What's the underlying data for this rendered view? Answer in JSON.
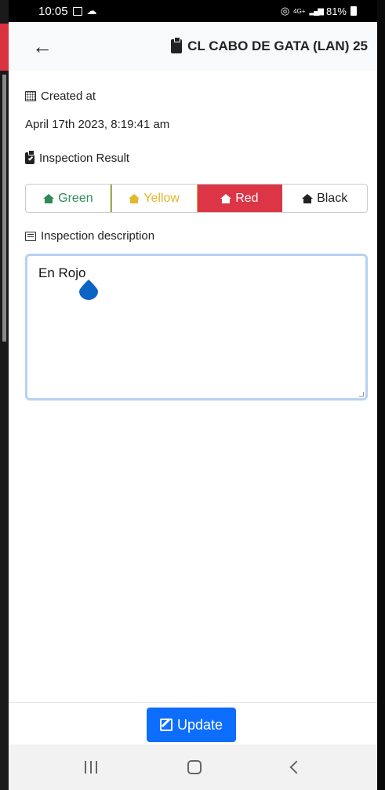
{
  "status": {
    "time": "10:05",
    "network": "4G+",
    "battery": "81%"
  },
  "header": {
    "back_icon": "arrow-left-icon",
    "title": "CL CABO DE GATA (LAN) 25"
  },
  "created": {
    "label": "Created at",
    "value": "April 17th 2023, 8:19:41 am"
  },
  "inspection_result": {
    "label": "Inspection Result",
    "options": [
      {
        "label": "Green",
        "color": "#2e8b57"
      },
      {
        "label": "Yellow",
        "color": "#e0b82a"
      },
      {
        "label": "Red",
        "color": "#dc3545",
        "selected": true
      },
      {
        "label": "Black",
        "color": "#222222"
      }
    ]
  },
  "description": {
    "label": "Inspection description",
    "value": "En Rojo"
  },
  "footer": {
    "update_label": "Update",
    "button_color": "#0d6efd"
  }
}
